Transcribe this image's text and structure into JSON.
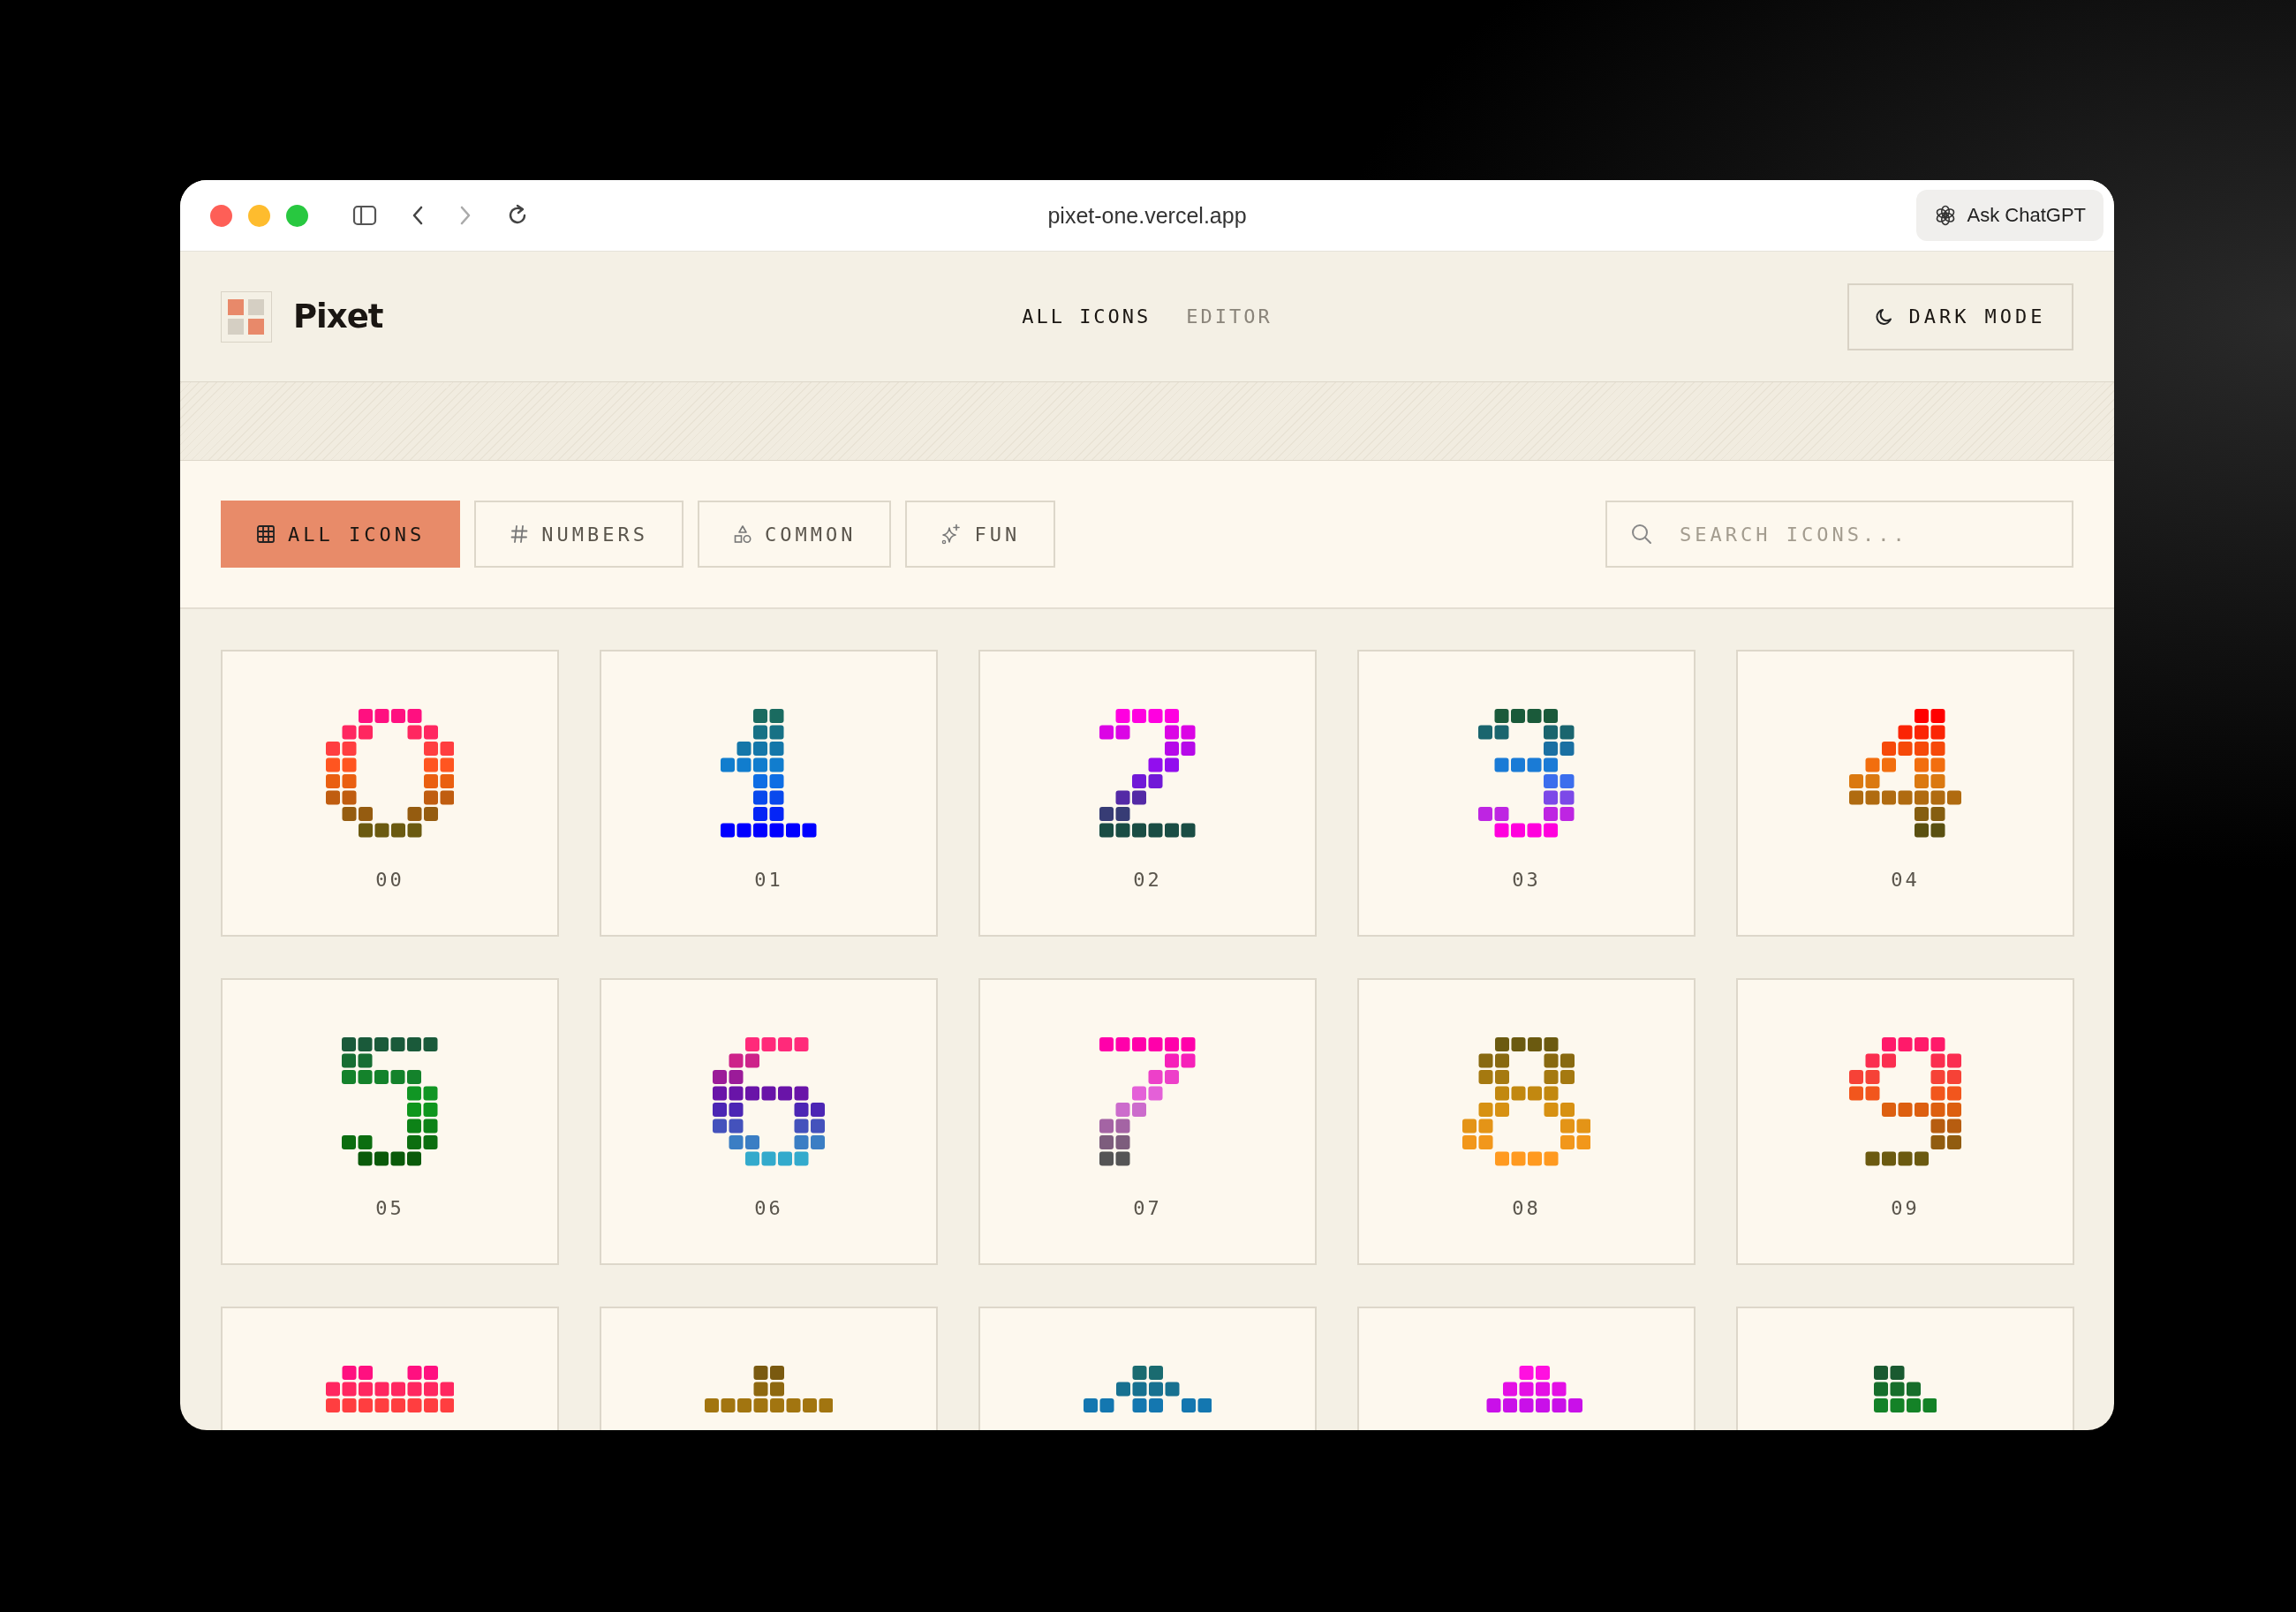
{
  "browser": {
    "url": "pixet-one.vercel.app",
    "assistant_button": "Ask ChatGPT"
  },
  "header": {
    "logo": "Pixet",
    "nav": [
      {
        "label": "ALL ICONS",
        "selected": true
      },
      {
        "label": "EDITOR",
        "selected": false
      }
    ],
    "theme_button": "DARK MODE"
  },
  "filters": [
    {
      "label": "ALL ICONS",
      "kind": "all",
      "selected": true
    },
    {
      "label": "NUMBERS",
      "kind": "numbers",
      "selected": false
    },
    {
      "label": "COMMON",
      "kind": "common",
      "selected": false
    },
    {
      "label": "FUN",
      "kind": "fun",
      "selected": false
    }
  ],
  "search": {
    "placeholder": "SEARCH ICONS..."
  },
  "icons": [
    {
      "label": "00",
      "cut_off": false
    },
    {
      "label": "01",
      "cut_off": false
    },
    {
      "label": "02",
      "cut_off": false
    },
    {
      "label": "03",
      "cut_off": false
    },
    {
      "label": "04",
      "cut_off": false
    },
    {
      "label": "05",
      "cut_off": false
    },
    {
      "label": "06",
      "cut_off": false
    },
    {
      "label": "07",
      "cut_off": false
    },
    {
      "label": "08",
      "cut_off": false
    },
    {
      "label": "09",
      "cut_off": false
    },
    {
      "cut_off": true
    },
    {
      "cut_off": true
    },
    {
      "cut_off": true
    },
    {
      "cut_off": true
    },
    {
      "cut_off": true
    }
  ]
}
